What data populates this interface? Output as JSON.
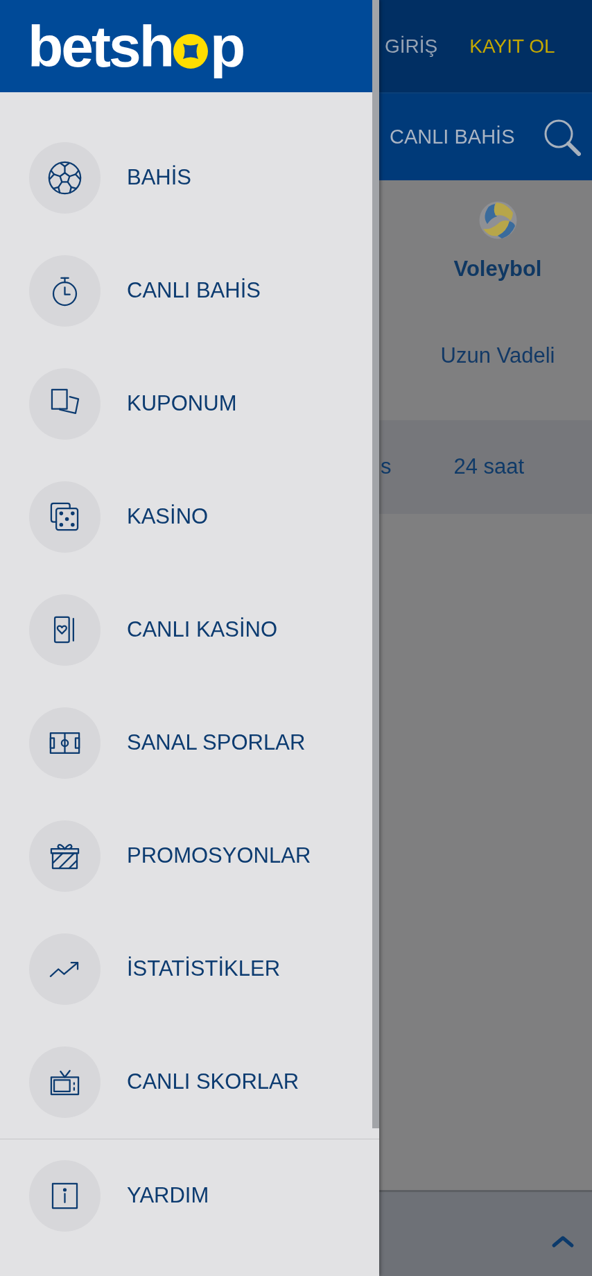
{
  "drawer": {
    "logo": {
      "parts": [
        "betsh",
        "p"
      ]
    },
    "menu": [
      {
        "label": "BAHİS"
      },
      {
        "label": "CANLI BAHİS"
      },
      {
        "label": "KUPONUM"
      },
      {
        "label": "KASİNO"
      },
      {
        "label": "CANLI KASİNO"
      },
      {
        "label": "SANAL SPORLAR"
      },
      {
        "label": "PROMOSYONLAR"
      },
      {
        "label": "İSTATİSTİKLER"
      },
      {
        "label": "CANLI SKORLAR"
      }
    ],
    "footer_menu": [
      {
        "label": "YARDIM"
      }
    ]
  },
  "background_page": {
    "top_bar": {
      "login": "GİRİŞ",
      "register": "KAYIT OL"
    },
    "nav_bar": {
      "item": "CANLI BAHİS"
    },
    "sports": [
      {
        "name": "Voleybol"
      }
    ],
    "category_tabs": [
      "Uzun Vadeli"
    ],
    "time_filters": [
      "s",
      "24 saat"
    ]
  }
}
